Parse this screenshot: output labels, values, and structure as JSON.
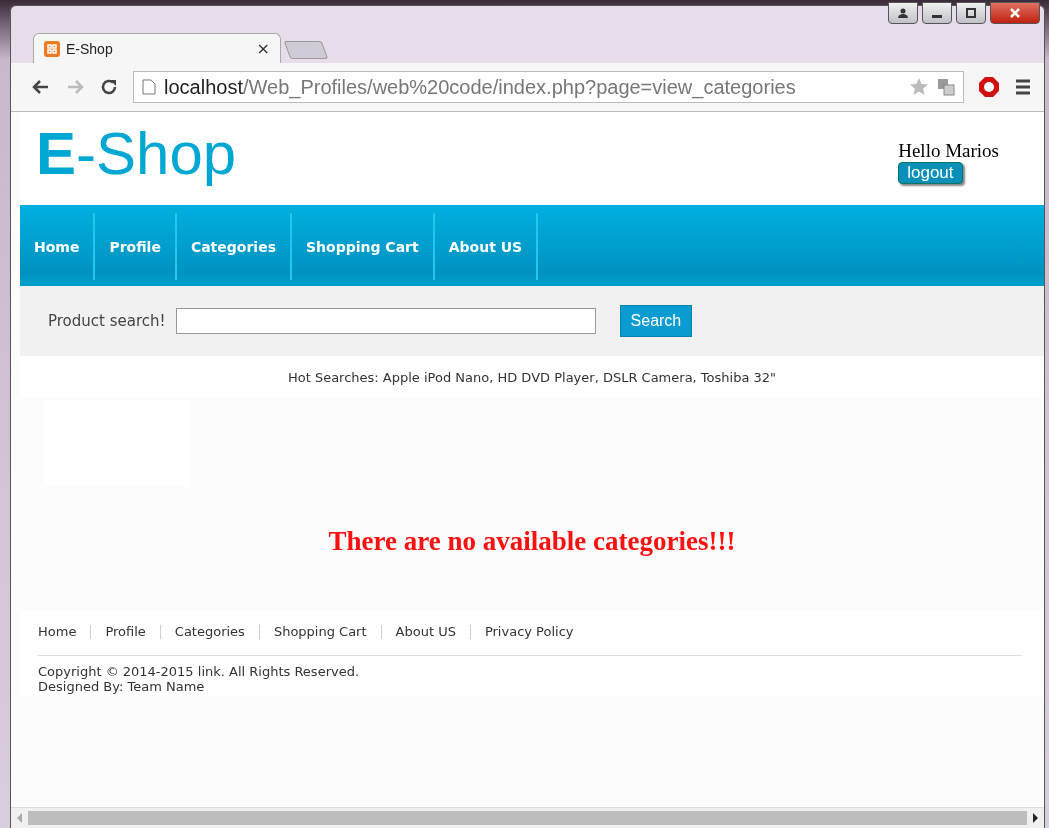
{
  "browser": {
    "tab_title": "E-Shop",
    "tab_close": "×",
    "url_host": "localhost",
    "url_path": "/Web_Profiles/web%20code/index.php?page=view_categories"
  },
  "header": {
    "logo": "**E**-Shop",
    "greeting": "Hello Marios",
    "logout": "logout"
  },
  "nav": [
    "Home",
    "Profile",
    "Categories",
    "Shopping Cart",
    "About US"
  ],
  "search": {
    "label": "Product search!",
    "button": "Search"
  },
  "hot_searches": "Hot Searches: Apple iPod Nano, HD DVD Player, DSLR Camera, Toshiba 32\"",
  "message": "There are no available categories!!!",
  "footer": {
    "links": [
      "Home",
      "Profile",
      "Categories",
      "Shopping Cart",
      "About US",
      "Privacy Policy"
    ],
    "copyright": "Copyright © 2014-2015 link. All Rights Reserved.",
    "designed_by": "Designed By: Team Name"
  }
}
